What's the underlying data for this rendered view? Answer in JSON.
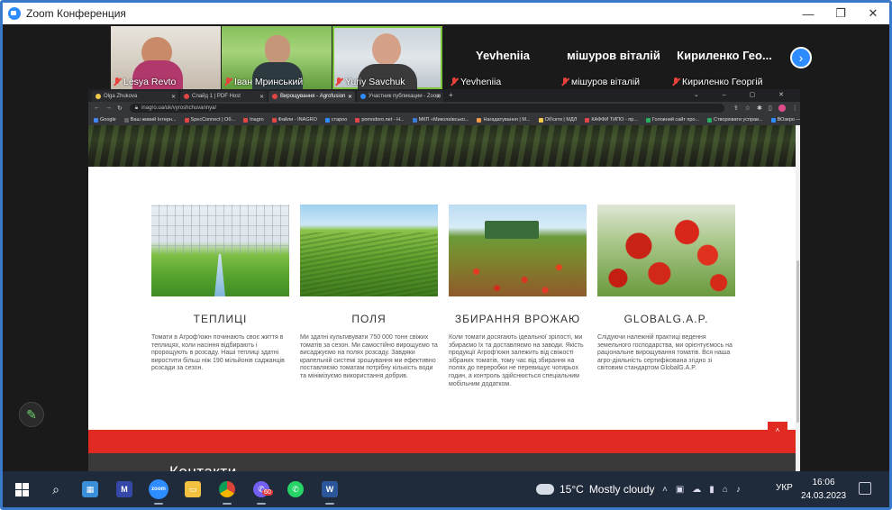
{
  "zoom": {
    "title": "Zoom Конференция",
    "window_controls": [
      "—",
      "❐",
      "✕"
    ],
    "participants": [
      {
        "name": "Lesya Revto",
        "muted": true
      },
      {
        "name": "Іван Мринський",
        "muted": true
      },
      {
        "name": "Yuriy Savchuk",
        "muted": true,
        "active": true
      },
      {
        "name": "Yevheniia",
        "muted": true,
        "display": "Yevheniia"
      },
      {
        "name": "мішуров віталій",
        "muted": true,
        "display": "мішуров віталій"
      },
      {
        "name": "Кириленко Георгій",
        "muted": true,
        "display": "Кириленко Гео..."
      }
    ],
    "next_icon": "chevron-right-icon"
  },
  "browser": {
    "tabs": [
      {
        "title": "Olga Zhukova",
        "color": "#f2c94c"
      },
      {
        "title": "Слайд 1 | PDF Host",
        "color": "#e04646"
      },
      {
        "title": "Вирощування - Agrofusion",
        "color": "#e04646",
        "active": true
      },
      {
        "title": "Участник публикации - Zoom",
        "color": "#2d8cff"
      }
    ],
    "url": "inagro.ua/uk/vyroshchuvannya/",
    "bookmarks": [
      {
        "label": "Google",
        "color": "#4285f4"
      },
      {
        "label": "Ваш живий Інтерн...",
        "color": "#666"
      },
      {
        "label": "SpecConnect | Об...",
        "color": "#e04646"
      },
      {
        "label": "Inagro",
        "color": "#e04646"
      },
      {
        "label": "Файли - INAGRO",
        "color": "#e04646"
      },
      {
        "label": "староо",
        "color": "#2d8cff"
      },
      {
        "label": "pomodoro.net - Н...",
        "color": "#e04646"
      },
      {
        "label": "МКП «Миколаївсько...",
        "color": "#3a7bd5"
      },
      {
        "label": "Нагадатування | М...",
        "color": "#f2994a"
      },
      {
        "label": "Об'єкти | МДЛ",
        "color": "#f2c94c"
      },
      {
        "label": "КАФФИ ТИПО - пр...",
        "color": "#e04646"
      },
      {
        "label": "Головний сайт про...",
        "color": "#27ae60"
      },
      {
        "label": "Створювати усправ...",
        "color": "#27ae60"
      },
      {
        "label": "ВОзеро — LatiEurd...",
        "color": "#2d8cff"
      }
    ]
  },
  "page": {
    "cards": [
      {
        "title": "ТЕПЛИЦІ",
        "text": "Томати в Агроф'южн починають своє життя в теплицях, коли насіння відбирають і пророщують в розсаду. Наші теплиці здатні виростити більш ніж 190 мільйонів саджанців розсади за сезон."
      },
      {
        "title": "ПОЛЯ",
        "text": "Ми здатні культивувати 750 000 тонн свіжих томатів за сезон. Ми самостійно вирощуємо та висаджуємо на полях розсаду. Завдяки крапельній системі зрошування ми ефективно поставляємо томатам потрібну кількість води та мінімізуємо використання добрив."
      },
      {
        "title": "ЗБИРАННЯ ВРОЖАЮ",
        "text": "Коли томати досягають ідеальної зрілості, ми збираємо їх та доставляємо на заводи. Якість продукції Агроф'южн залежить від свіжості зібраних томатів, тому час від збирання на полях до переробки не перевищує чотирьох годин, а контроль здійснюється спеціальним мобільним додатком."
      },
      {
        "title": "GLOBALG.A.P.",
        "text": "Слідуючи належній практиці ведення земельного господарства, ми орієнтуємось на раціональне вирощування томатів. Вся наша агро-діяльність сертифікована згідно зі світовим стандартом GlobalG.A.P."
      }
    ],
    "footer_heading": "Контакти",
    "scroll_up_icon": "chevron-up-icon"
  },
  "taskbar": {
    "weather": "15°C",
    "weather_desc": "Mostly cloudy",
    "language": "УКР",
    "time": "16:06",
    "date": "24.03.2023",
    "viber_badge": "60"
  }
}
